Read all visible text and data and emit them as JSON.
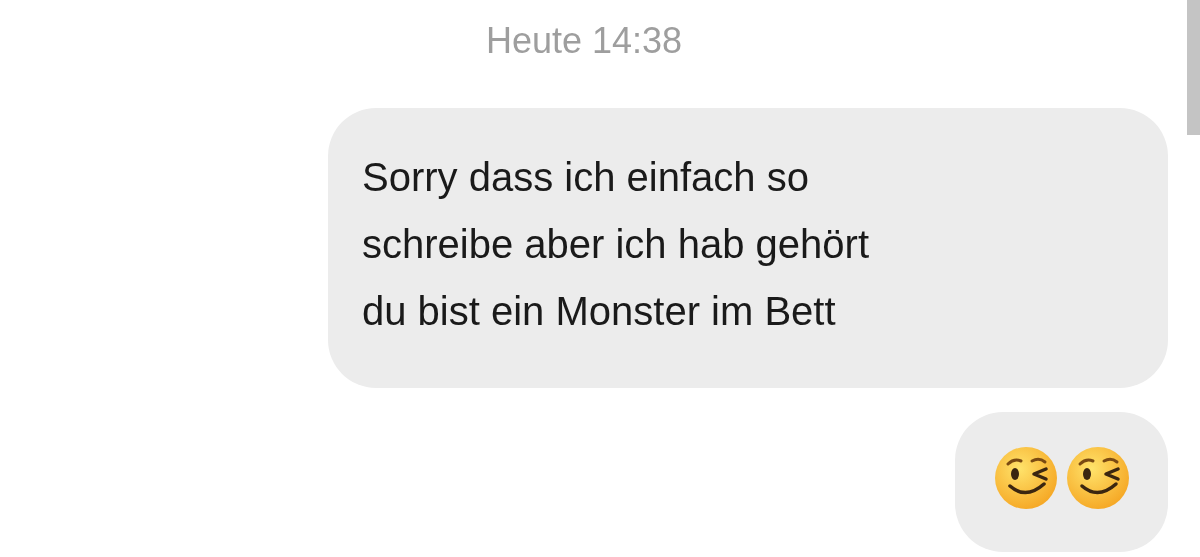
{
  "timestamp": "Heute 14:38",
  "messages": [
    {
      "kind": "text",
      "text": "Sorry dass ich einfach so\nschreibe aber ich hab gehört\ndu bist ein Monster im Bett"
    },
    {
      "kind": "emoji",
      "emojis": [
        {
          "kind": "wink"
        },
        {
          "kind": "wink"
        }
      ]
    }
  ]
}
